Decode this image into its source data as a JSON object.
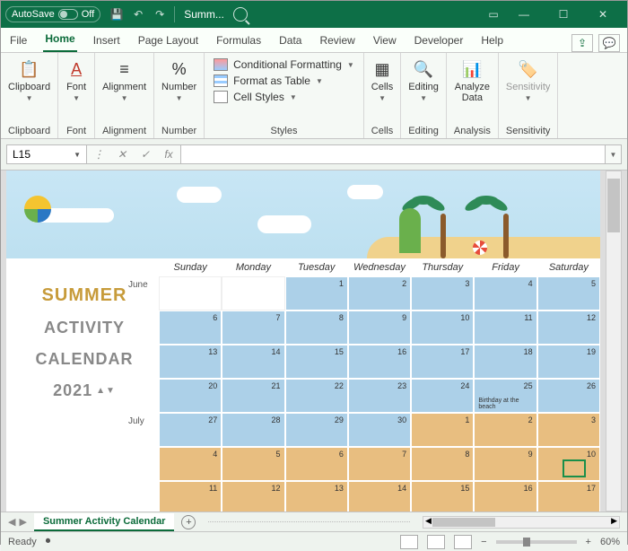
{
  "titlebar": {
    "autosave_label": "AutoSave",
    "autosave_state": "Off",
    "doc_title": "Summ..."
  },
  "tabs": {
    "items": [
      "File",
      "Home",
      "Insert",
      "Page Layout",
      "Formulas",
      "Data",
      "Review",
      "View",
      "Developer",
      "Help"
    ],
    "active_index": 1
  },
  "ribbon": {
    "groups": {
      "clipboard": {
        "label": "Clipboard",
        "btn": "Clipboard"
      },
      "font": {
        "label": "Font",
        "btn": "Font"
      },
      "alignment": {
        "label": "Alignment",
        "btn": "Alignment"
      },
      "number": {
        "label": "Number",
        "btn": "Number"
      },
      "styles": {
        "label": "Styles",
        "cf": "Conditional Formatting",
        "fat": "Format as Table",
        "cs": "Cell Styles"
      },
      "cells": {
        "label": "Cells",
        "btn": "Cells"
      },
      "editing": {
        "label": "Editing",
        "btn": "Editing"
      },
      "analysis": {
        "label": "Analysis",
        "btn": "Analyze Data"
      },
      "sensitivity": {
        "label": "Sensitivity",
        "btn": "Sensitivity"
      }
    }
  },
  "namebox": {
    "value": "L15"
  },
  "fx": {
    "label": "fx"
  },
  "calendar": {
    "title": {
      "l1": "SUMMER",
      "l2": "ACTIVITY",
      "l3": "CALENDAR",
      "year": "2021"
    },
    "days": [
      "Sunday",
      "Monday",
      "Tuesday",
      "Wednesday",
      "Thursday",
      "Friday",
      "Saturday"
    ],
    "months": {
      "m1": "June",
      "m2": "July"
    },
    "event": "Birthday at the beach",
    "weeks": [
      {
        "month": "June",
        "cells": [
          {
            "n": "",
            "c": "blank"
          },
          {
            "n": "",
            "c": "blank"
          },
          {
            "n": "1",
            "c": "blue"
          },
          {
            "n": "2",
            "c": "blue"
          },
          {
            "n": "3",
            "c": "blue"
          },
          {
            "n": "4",
            "c": "blue"
          },
          {
            "n": "5",
            "c": "blue"
          }
        ]
      },
      {
        "month": "",
        "cells": [
          {
            "n": "6",
            "c": "blue"
          },
          {
            "n": "7",
            "c": "blue"
          },
          {
            "n": "8",
            "c": "blue"
          },
          {
            "n": "9",
            "c": "blue"
          },
          {
            "n": "10",
            "c": "blue"
          },
          {
            "n": "11",
            "c": "blue"
          },
          {
            "n": "12",
            "c": "blue"
          }
        ]
      },
      {
        "month": "",
        "cells": [
          {
            "n": "13",
            "c": "blue"
          },
          {
            "n": "14",
            "c": "blue"
          },
          {
            "n": "15",
            "c": "blue"
          },
          {
            "n": "16",
            "c": "blue"
          },
          {
            "n": "17",
            "c": "blue"
          },
          {
            "n": "18",
            "c": "blue"
          },
          {
            "n": "19",
            "c": "blue"
          }
        ]
      },
      {
        "month": "",
        "cells": [
          {
            "n": "20",
            "c": "blue"
          },
          {
            "n": "21",
            "c": "blue"
          },
          {
            "n": "22",
            "c": "blue"
          },
          {
            "n": "23",
            "c": "blue"
          },
          {
            "n": "24",
            "c": "blue"
          },
          {
            "n": "25",
            "c": "blue",
            "note": true
          },
          {
            "n": "26",
            "c": "blue"
          }
        ]
      },
      {
        "month": "July",
        "cells": [
          {
            "n": "27",
            "c": "blue"
          },
          {
            "n": "28",
            "c": "blue"
          },
          {
            "n": "29",
            "c": "blue"
          },
          {
            "n": "30",
            "c": "blue"
          },
          {
            "n": "1",
            "c": "tan"
          },
          {
            "n": "2",
            "c": "tan"
          },
          {
            "n": "3",
            "c": "tan"
          }
        ]
      },
      {
        "month": "",
        "cells": [
          {
            "n": "4",
            "c": "tan"
          },
          {
            "n": "5",
            "c": "tan"
          },
          {
            "n": "6",
            "c": "tan"
          },
          {
            "n": "7",
            "c": "tan"
          },
          {
            "n": "8",
            "c": "tan"
          },
          {
            "n": "9",
            "c": "tan"
          },
          {
            "n": "10",
            "c": "tan"
          }
        ]
      },
      {
        "month": "",
        "cells": [
          {
            "n": "11",
            "c": "tan"
          },
          {
            "n": "12",
            "c": "tan"
          },
          {
            "n": "13",
            "c": "tan"
          },
          {
            "n": "14",
            "c": "tan"
          },
          {
            "n": "15",
            "c": "tan"
          },
          {
            "n": "16",
            "c": "tan"
          },
          {
            "n": "17",
            "c": "tan"
          }
        ]
      }
    ]
  },
  "sheet_tab": {
    "name": "Summer Activity Calendar"
  },
  "status": {
    "ready": "Ready",
    "zoom": "60%"
  }
}
